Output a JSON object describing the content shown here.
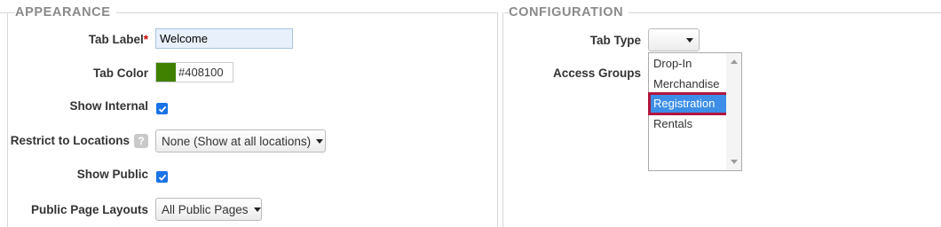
{
  "appearance": {
    "title": "APPEARANCE",
    "tab_label": {
      "label": "Tab Label",
      "required_mark": "*",
      "value": "Welcome"
    },
    "tab_color": {
      "label": "Tab Color",
      "value": "#408100",
      "swatch": "#408100"
    },
    "show_internal": {
      "label": "Show Internal",
      "checked": true
    },
    "restrict_locations": {
      "label": "Restrict to Locations",
      "help": "?",
      "value": "None (Show at all locations)"
    },
    "show_public": {
      "label": "Show Public",
      "checked": true
    },
    "public_page_layouts": {
      "label": "Public Page Layouts",
      "value": "All Public Pages"
    }
  },
  "configuration": {
    "title": "CONFIGURATION",
    "tab_type": {
      "label": "Tab Type",
      "value": ""
    },
    "access_groups": {
      "label": "Access Groups",
      "options": [
        "Drop-In",
        "Merchandise",
        "Registration",
        "Rentals"
      ],
      "selected": "Registration"
    }
  },
  "colors": {
    "accent": "#1a73e8",
    "selection": "#3d8ee8",
    "highlight_border": "#b0163d",
    "required": "#cc0000"
  },
  "icons": {
    "check": "check-icon",
    "caret": "caret-down-icon",
    "help": "help-icon"
  }
}
